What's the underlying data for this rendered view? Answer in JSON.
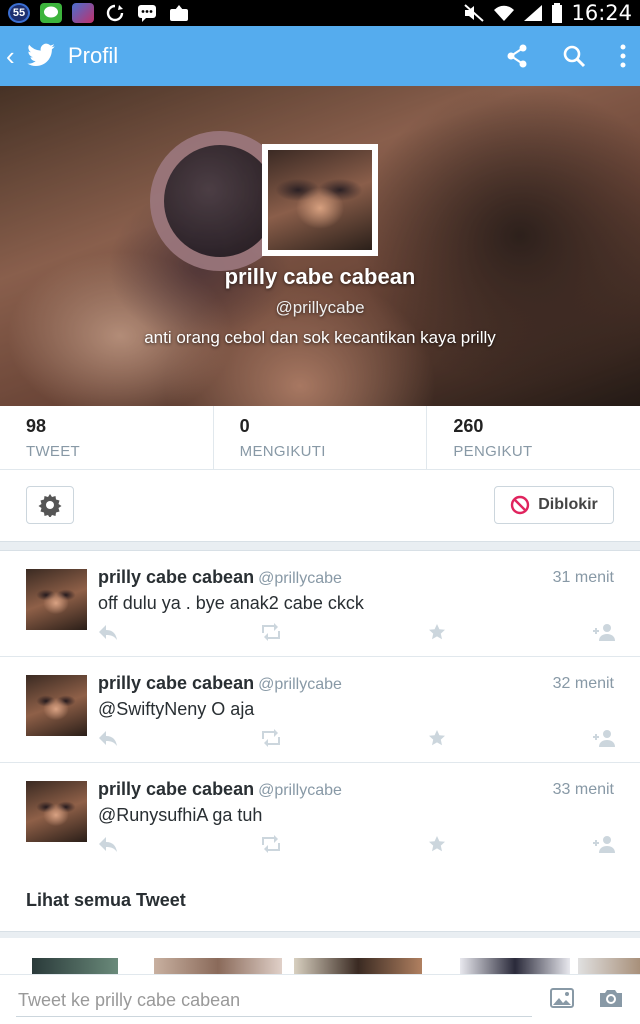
{
  "status_bar": {
    "badge_number": "55",
    "app_icons": [
      "badge-55-icon",
      "line-icon",
      "game-icon",
      "sync-icon",
      "bbm-icon",
      "upload-icon"
    ],
    "system_icons": [
      "mute-icon",
      "wifi-icon",
      "signal-icon",
      "battery-icon"
    ],
    "time": "16:24"
  },
  "action_bar": {
    "title": "Profil",
    "back_glyph": "‹",
    "actions": [
      "share-icon",
      "search-icon",
      "overflow-menu-icon"
    ],
    "color": "#55acee"
  },
  "profile": {
    "name": "prilly cabe cabean",
    "handle": "@prillycabe",
    "bio": "anti orang cebol dan sok kecantikan kaya prilly"
  },
  "stats": [
    {
      "value": "98",
      "label": "TWEET"
    },
    {
      "value": "0",
      "label": "MENGIKUTI"
    },
    {
      "value": "260",
      "label": "PENGIKUT"
    }
  ],
  "actions_row": {
    "blocked_label": "Diblokir"
  },
  "tweets": [
    {
      "name": "prilly cabe cabean",
      "handle": "@prillycabe",
      "time": "31 menit",
      "text": "off dulu ya . bye anak2 cabe ckck"
    },
    {
      "name": "prilly cabe cabean",
      "handle": "@prillycabe",
      "time": "32 menit",
      "text": "@SwiftyNeny O aja"
    },
    {
      "name": "prilly cabe cabean",
      "handle": "@prillycabe",
      "time": "33 menit",
      "text": "@RunysufhiA ga tuh"
    }
  ],
  "see_all_label": "Lihat semua Tweet",
  "compose": {
    "placeholder": "Tweet ke prilly cabe cabean"
  }
}
